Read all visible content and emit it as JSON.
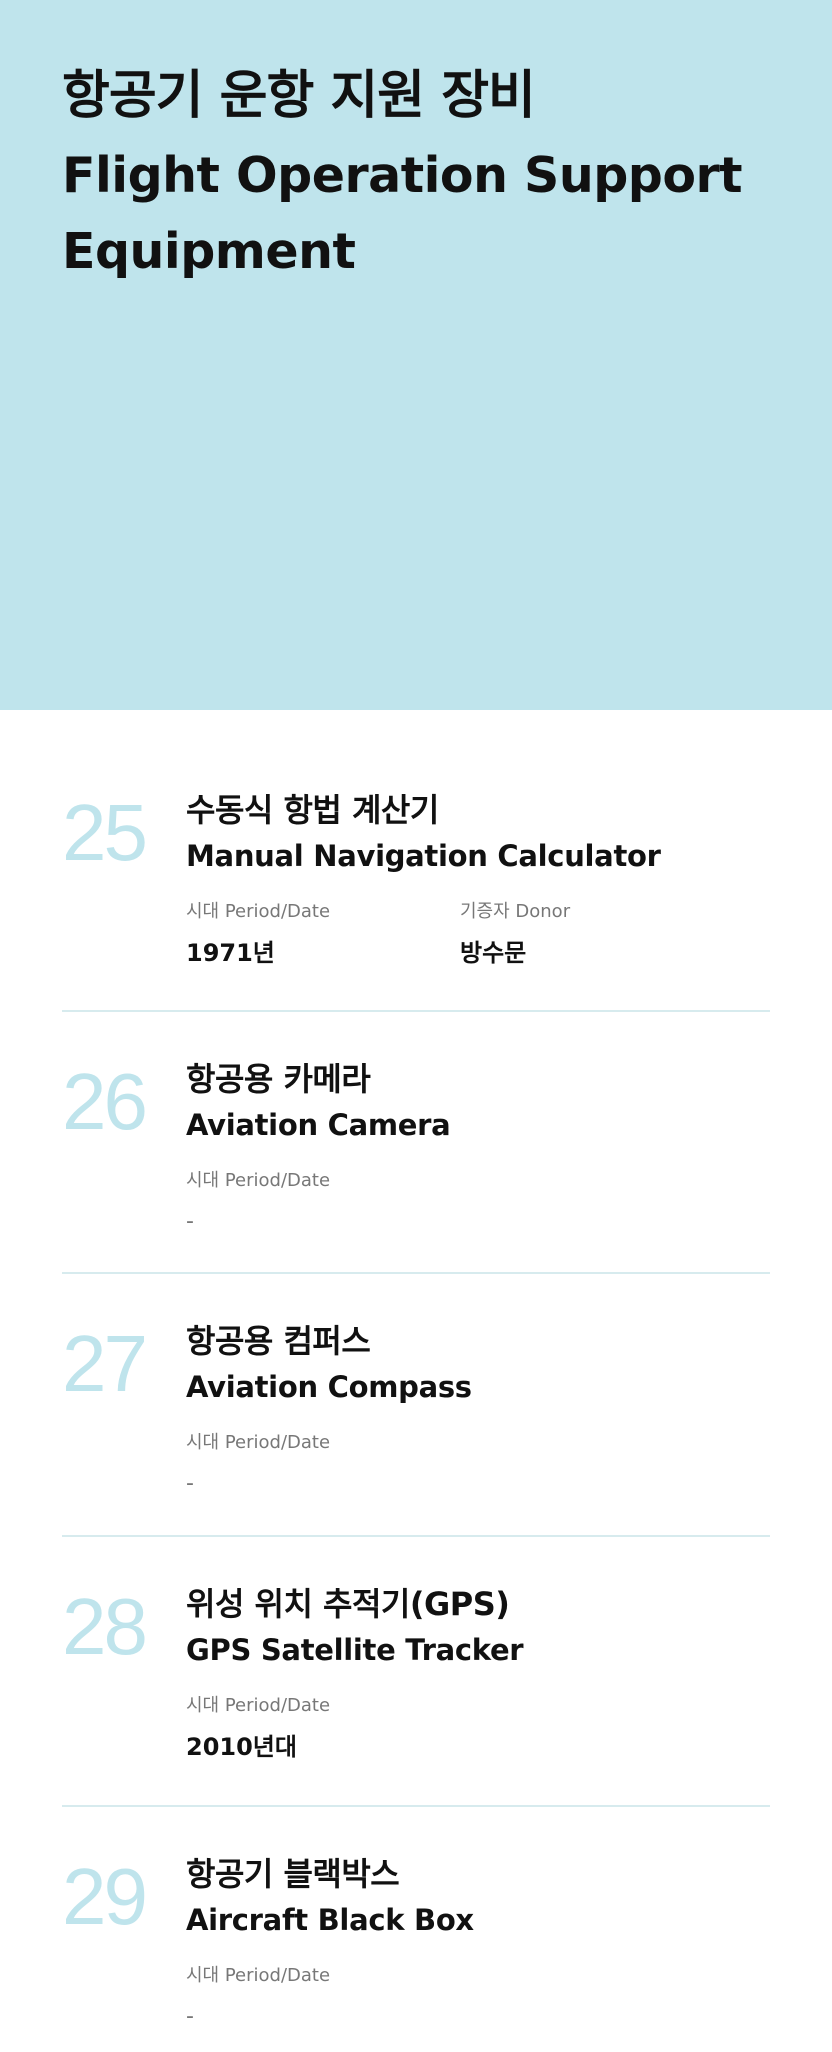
{
  "hero": {
    "title_ko": "항공기 운항 지원 장비",
    "title_en": "Flight Operation Support Equipment"
  },
  "colors": {
    "hero_bg": "#bfe4ec",
    "number": "#bfe4ec",
    "divider": "#d7ebee",
    "text": "#111111",
    "label": "#777777"
  },
  "items": [
    {
      "number": "25",
      "title_ko": "수동식 항법 계산기",
      "title_en": "Manual Navigation Calculator",
      "period_label": "시대 Period/Date",
      "period_value": "1971년",
      "donor_label": "기증자 Donor",
      "donor_value": "방수문"
    },
    {
      "number": "26",
      "title_ko": "항공용 카메라",
      "title_en": "Aviation Camera",
      "period_label": "시대 Period/Date",
      "period_value": "-"
    },
    {
      "number": "27",
      "title_ko": "항공용 컴퍼스",
      "title_en": "Aviation Compass",
      "period_label": "시대 Period/Date",
      "period_value": "-"
    },
    {
      "number": "28",
      "title_ko": "위성 위치 추적기(GPS)",
      "title_en": "GPS Satellite Tracker",
      "period_label": "시대 Period/Date",
      "period_value": "2010년대"
    },
    {
      "number": "29",
      "title_ko": "항공기 블랙박스",
      "title_en": "Aircraft Black Box",
      "period_label": "시대 Period/Date",
      "period_value": "-"
    }
  ]
}
